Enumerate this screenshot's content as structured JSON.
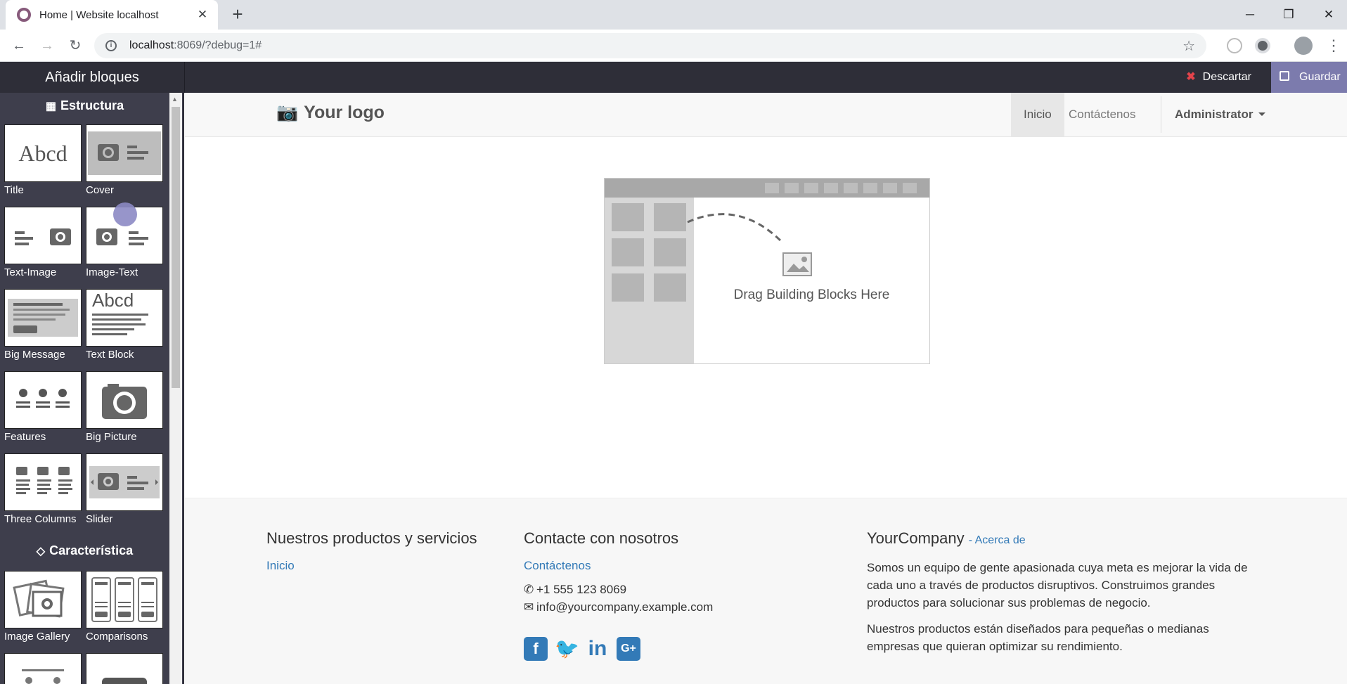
{
  "browser": {
    "tab_title": "Home | Website localhost",
    "url_host": "localhost",
    "url_rest": ":8069/?debug=1#"
  },
  "editor": {
    "panel_title": "Añadir bloques",
    "discard_label": "Descartar",
    "save_label": "Guardar"
  },
  "sidebar": {
    "section_structure": "Estructura",
    "section_features": "Característica",
    "structure_blocks": [
      "Title",
      "Cover",
      "Text-Image",
      "Image-Text",
      "Big Message",
      "Text Block",
      "Features",
      "Big Picture",
      "Three Columns",
      "Slider"
    ],
    "feature_blocks": [
      "Image Gallery",
      "Comparisons"
    ],
    "title_thumb_text": "Abcd"
  },
  "site": {
    "logo_text": "Your logo",
    "nav": [
      "Inicio",
      "Contáctenos"
    ],
    "nav_user": "Administrator",
    "drop_hint": "Drag Building Blocks Here"
  },
  "footer": {
    "col1_title": "Nuestros productos y servicios",
    "col1_link": "Inicio",
    "col2_title": "Contacte con nosotros",
    "col2_link": "Contáctenos",
    "phone": "+1 555 123 8069",
    "email": "info@yourcompany.example.com",
    "col3_title": "YourCompany",
    "col3_sub": "- Acerca de",
    "about_p1": "Somos un equipo de gente apasionada cuya meta es mejorar la vida de cada uno a través de productos disruptivos. Construimos grandes productos para solucionar sus problemas de negocio.",
    "about_p2": "Nuestros productos están diseñados para pequeñas o medianas empresas que quieran optimizar su rendimiento.",
    "social_icons": [
      "facebook-icon",
      "twitter-icon",
      "linkedin-icon",
      "google-plus-icon"
    ]
  },
  "colors": {
    "editbar_bg": "#2e2e38",
    "save_accent": "#7c7bad",
    "discard_x": "#e2434b",
    "link": "#337ab7"
  }
}
